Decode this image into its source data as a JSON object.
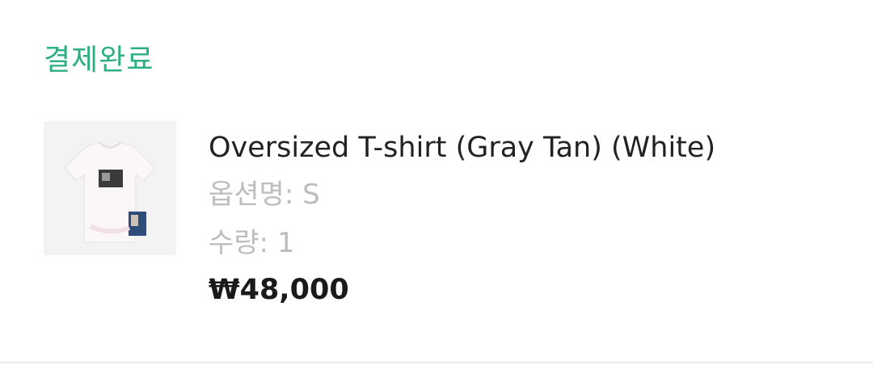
{
  "order": {
    "status_label": "결제완료"
  },
  "item": {
    "name": "Oversized T-shirt (Gray Tan) (White)",
    "option_label": "옵션명",
    "option_value": "S",
    "quantity_label": "수량",
    "quantity_value": "1",
    "price": "₩48,000"
  },
  "colors": {
    "status": "#2bb07f",
    "muted": "#bdbdbd",
    "text": "#222222"
  }
}
